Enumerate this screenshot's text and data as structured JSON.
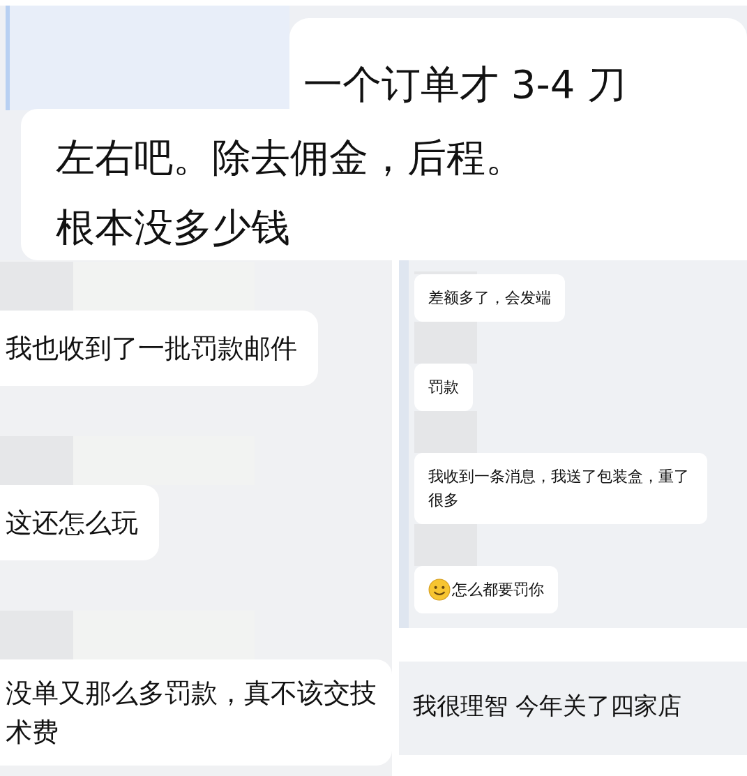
{
  "top_panel": {
    "message": {
      "lines": [
        "一个订单才 3-4 刀",
        "左右吧。除去佣金，后程。",
        "根本没多少钱"
      ]
    }
  },
  "left_panel": {
    "messages": [
      {
        "text": "我也收到了一批罚款邮件"
      },
      {
        "text": "这还怎么玩"
      },
      {
        "text": "没单又那么多罚款，真不该交技术费"
      }
    ]
  },
  "right_panel": {
    "messages": [
      {
        "kind": "text",
        "text": "差额多了，会发端"
      },
      {
        "kind": "text",
        "text": "罚款"
      },
      {
        "kind": "text",
        "text": "我收到一条消息，我送了包装盒，重了很多"
      },
      {
        "kind": "emoji",
        "text": "怎么都要罚你"
      }
    ]
  },
  "bottom_right_panel": {
    "message": {
      "text": "我很理智 今年关了四家店"
    }
  }
}
